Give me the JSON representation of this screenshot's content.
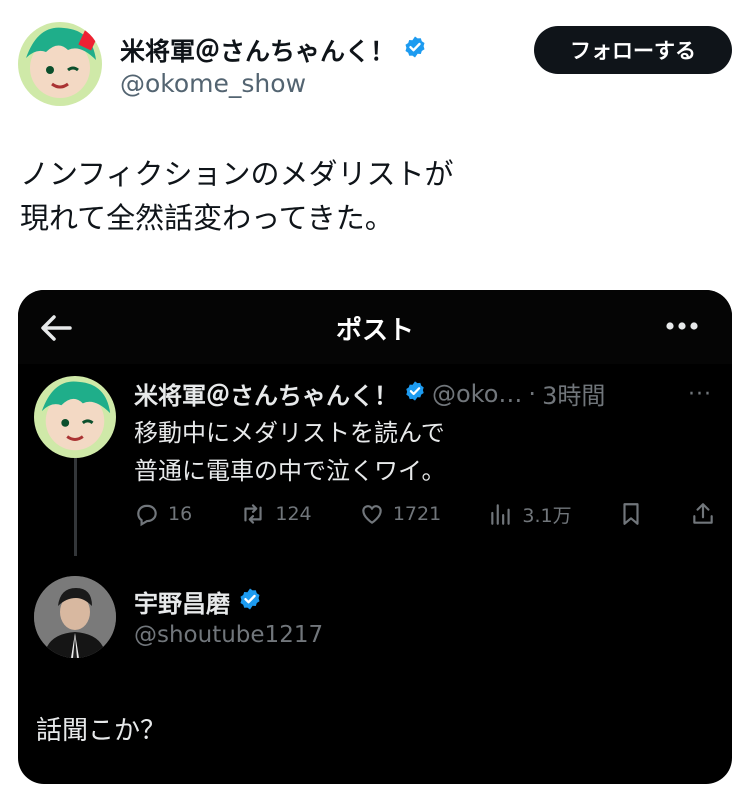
{
  "author": {
    "name": "米将軍＠さんちゃんく！",
    "handle": "@okome_show",
    "verified": true,
    "follow_label": "フォローする"
  },
  "tweet": {
    "lines": [
      "ノンフィクションのメダリストが",
      "現れて全然話変わってきた。"
    ]
  },
  "embedded": {
    "header_title": "ポスト",
    "post": {
      "name": "米将軍＠さんちゃんく！",
      "handle": "@oko…",
      "separator": "·",
      "time": "3時間",
      "more": "···",
      "lines": [
        "移動中にメダリストを読んで",
        "普通に電車の中で泣くワイ。"
      ],
      "replies": "16",
      "reposts": "124",
      "likes": "1721",
      "views": "3.1万"
    },
    "reply": {
      "name": "宇野昌磨",
      "handle": "@shoutube1217",
      "text": "話聞こか？"
    }
  },
  "colors": {
    "verified_blue": "#1d9bf0",
    "follow_button_bg": "#0f1419",
    "embedded_bg": "#000000",
    "muted_light": "#536471",
    "muted_dark": "#71767b"
  }
}
